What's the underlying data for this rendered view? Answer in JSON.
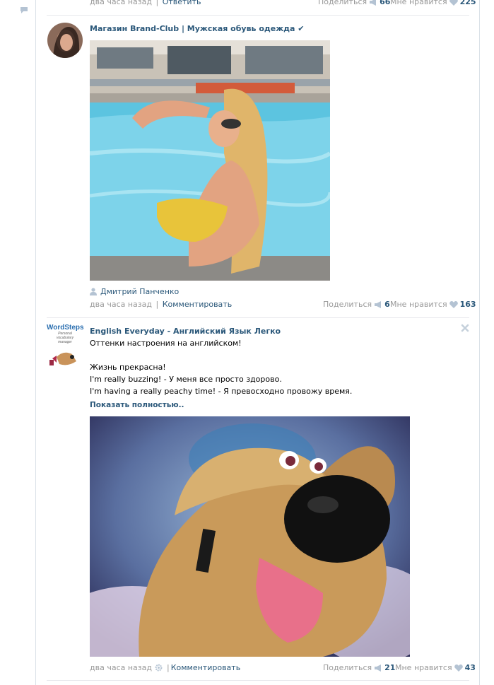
{
  "top_meta": {
    "time": "два часа назад",
    "reply": "Ответить",
    "share_label": "Поделиться",
    "share_count": "66",
    "like_label": "Мне нравится",
    "like_count": "225"
  },
  "post1": {
    "author": "Магазин Brand-Club | Мужская обувь одежда ✔",
    "signer": "Дмитрий Панченко",
    "time": "два часа назад",
    "comment": "Комментировать",
    "share_label": "Поделиться",
    "share_count": "6",
    "like_label": "Мне нравится",
    "like_count": "163"
  },
  "post2": {
    "author": "English Everyday - Английский Язык Легко",
    "avatar_brand": "WordSteps",
    "avatar_sub": "Personal vocabulary manager",
    "lines": [
      "Оттенки настроения на английском!",
      "",
      "Жизнь прекрасна!",
      "I'm really buzzing! - У меня все просто здорово.",
      "I'm having a really peachy time! - Я превосходно провожу время."
    ],
    "show_more": "Показать полностью..",
    "time": "два часа назад",
    "comment": "Комментировать",
    "share_label": "Поделиться",
    "share_count": "21",
    "like_label": "Мне нравится",
    "like_count": "43"
  },
  "colors": {
    "link": "#2b587a",
    "muted": "#999999",
    "divider": "#e7e8ec",
    "icon": "#b4c3d3"
  }
}
